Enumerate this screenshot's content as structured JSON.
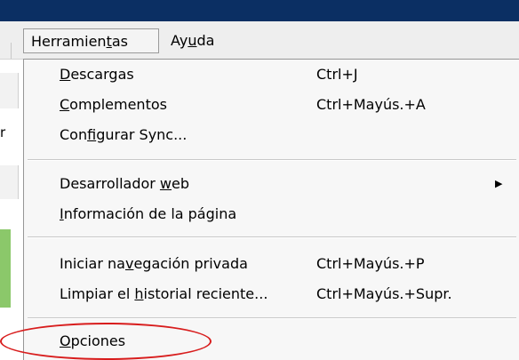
{
  "menubar": {
    "menus": [
      {
        "pre": "Herramien",
        "key": "t",
        "post": "as"
      },
      {
        "pre": "Ay",
        "key": "u",
        "post": "da"
      }
    ]
  },
  "background": {
    "fragment_r": "r"
  },
  "dropdown": {
    "items": [
      {
        "pre": "",
        "key": "D",
        "post": "escargas",
        "shortcut": "Ctrl+J"
      },
      {
        "pre": "",
        "key": "C",
        "post": "omplementos",
        "shortcut": "Ctrl+Mayús.+A"
      },
      {
        "pre": "Con",
        "key": "f",
        "post": "igurar Sync...",
        "shortcut": ""
      },
      {
        "pre": "Desarrollador ",
        "key": "w",
        "post": "eb",
        "shortcut": "",
        "submenu": true
      },
      {
        "pre": "",
        "key": "I",
        "post": "nformación de la página",
        "shortcut": ""
      },
      {
        "pre": "Iniciar na",
        "key": "v",
        "post": "egación privada",
        "shortcut": "Ctrl+Mayús.+P"
      },
      {
        "pre": "Limpiar el ",
        "key": "h",
        "post": "istorial reciente...",
        "shortcut": "Ctrl+Mayús.+Supr."
      },
      {
        "pre": "",
        "key": "O",
        "post": "pciones",
        "shortcut": ""
      }
    ]
  },
  "annotation": {
    "color": "#d81d1d"
  }
}
